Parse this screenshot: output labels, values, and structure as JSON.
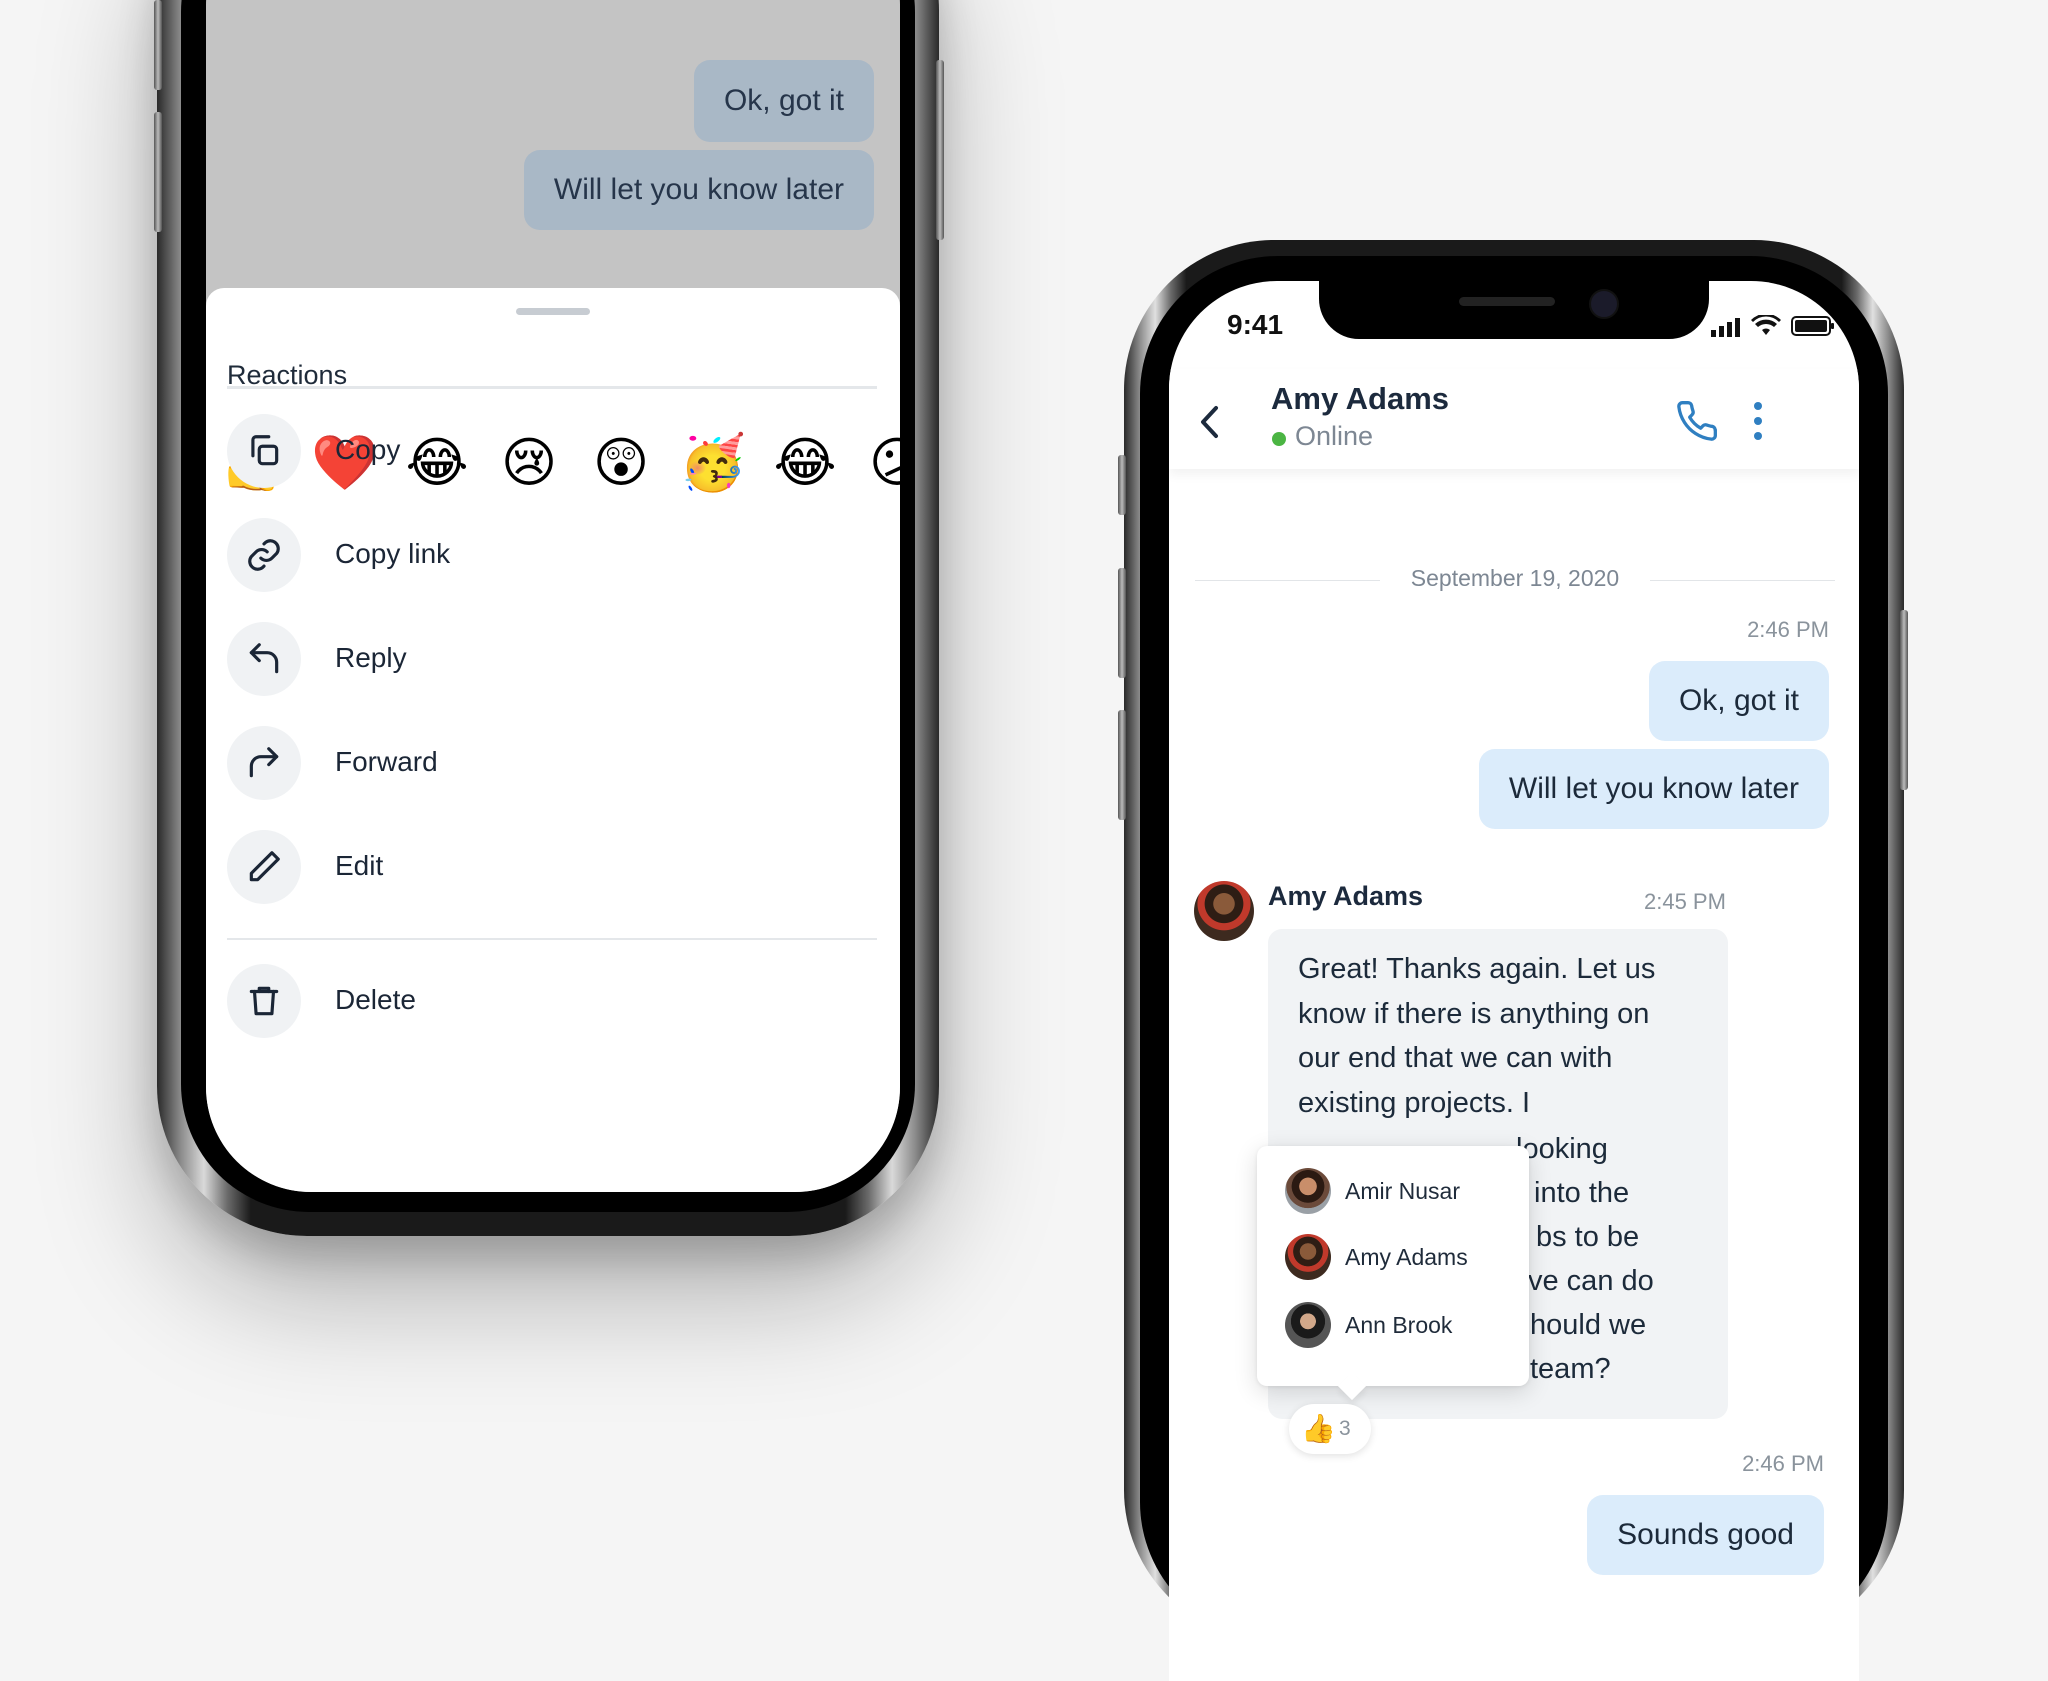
{
  "left_phone": {
    "bubbles": [
      "Ok, got it",
      "Will let you know later"
    ],
    "sheet": {
      "reactions_title": "Reactions",
      "emojis": [
        "👍",
        "❤️",
        "😂",
        "😢",
        "😲",
        "🥳",
        "😂",
        "😕"
      ],
      "menu": [
        {
          "label": "Copy",
          "icon": "copy-icon"
        },
        {
          "label": "Copy link",
          "icon": "link-icon"
        },
        {
          "label": "Reply",
          "icon": "reply-icon"
        },
        {
          "label": "Forward",
          "icon": "forward-icon"
        },
        {
          "label": "Edit",
          "icon": "pencil-icon"
        },
        {
          "label": "Delete",
          "icon": "trash-icon"
        }
      ]
    }
  },
  "right_phone": {
    "status_time": "9:41",
    "header": {
      "name": "Amy Adams",
      "status": "Online"
    },
    "date_separator": "September 19, 2020",
    "messages": {
      "out_time_1": "2:46 PM",
      "out_1": "Ok, got it",
      "out_2": "Will let you know later",
      "in_sender": "Amy Adams",
      "in_time": "2:45 PM",
      "in_text": "Great! Thanks again. Let us know if there is anything on our end that we can with existing projects. I",
      "in_text_visible_fragments": [
        "looking",
        "into the",
        "bs to be",
        "ve can do",
        "hould we",
        "team?"
      ],
      "out_time_2": "2:46 PM",
      "out_3": "Sounds good"
    },
    "reactors": [
      "Amir Nusar",
      "Amy Adams",
      "Ann Brook"
    ],
    "reaction": {
      "emoji": "👍",
      "count": "3"
    }
  },
  "colors": {
    "outgoing_bubble": "#dbecfb",
    "incoming_bubble": "#f1f3f5",
    "online": "#4bb543",
    "accent": "#2f7fc1"
  }
}
